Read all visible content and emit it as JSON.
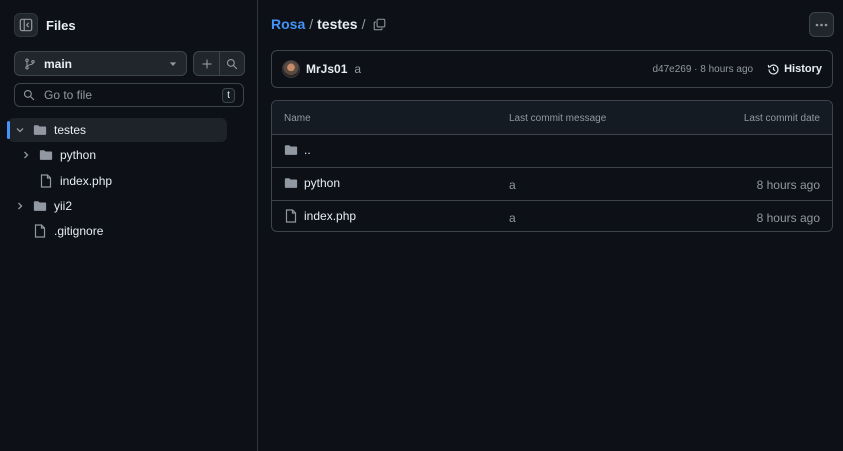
{
  "sidebar": {
    "title": "Files",
    "branch": "main",
    "goto_placeholder": "Go to file",
    "goto_shortcut": "t",
    "tree": [
      {
        "label": "testes",
        "type": "folder",
        "expanded": true
      },
      {
        "label": "python",
        "type": "folder",
        "expanded": false
      },
      {
        "label": "index.php",
        "type": "file"
      },
      {
        "label": "yii2",
        "type": "folder",
        "expanded": false
      },
      {
        "label": ".gitignore",
        "type": "file"
      }
    ]
  },
  "breadcrumb": {
    "root": "Rosa",
    "separator": "/",
    "current": "testes",
    "trailing": "/"
  },
  "commit": {
    "author": "MrJs01",
    "message": "a",
    "meta": "d47e269 · 8 hours ago",
    "history_label": "History"
  },
  "table": {
    "headers": {
      "name": "Name",
      "message": "Last commit message",
      "date": "Last commit date"
    },
    "rows": [
      {
        "name": "..",
        "type": "parent",
        "message": "",
        "date": ""
      },
      {
        "name": "python",
        "type": "folder",
        "message": "a",
        "date": "8 hours ago"
      },
      {
        "name": "index.php",
        "type": "file",
        "message": "a",
        "date": "8 hours ago"
      }
    ]
  },
  "colors": {
    "background": "#0d1117",
    "accent": "#4493f8",
    "border": "#3d444d",
    "muted": "#9198a1"
  }
}
